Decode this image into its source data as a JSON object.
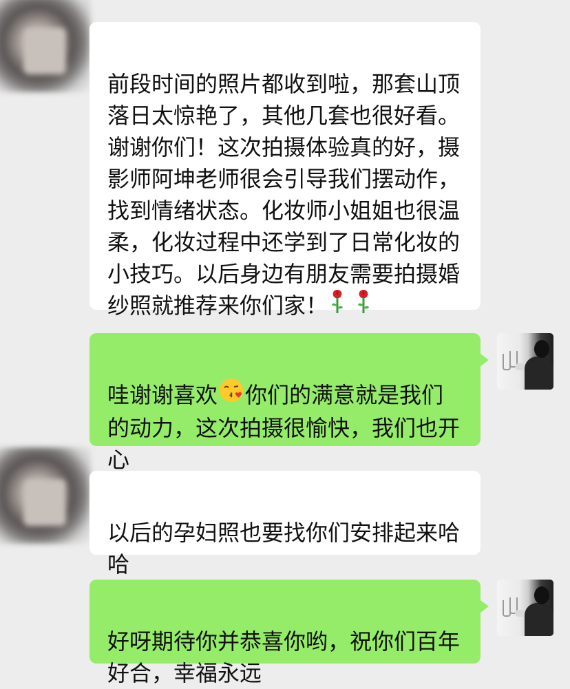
{
  "chat": {
    "messages": [
      {
        "side": "in",
        "text_before": "前段时间的照片都收到啦，那套山顶落日太惊艳了，其他几套也很好看。谢谢你们！这次拍摄体验真的好，摄影师阿坤老师很会引导我们摆动作，找到情绪状态。化妆师小姐姐也很温柔，化妆过程中还学到了日常化妆的小技巧。以后身边有朋友需要拍摄婚纱照就推荐来你们家！",
        "emoji": "rose-emoji x2"
      },
      {
        "side": "out",
        "text_before": "哇谢谢喜欢",
        "emoji": "kissing-face-emoji",
        "text_after": "你们的满意就是我们的动力，这次拍摄很愉快，我们也开心"
      },
      {
        "side": "in",
        "text_before": "以后的孕妇照也要找你们安排起来哈哈"
      },
      {
        "side": "out",
        "text_before": "好呀期待你并恭喜你哟，祝你们百年好合，幸福永远"
      }
    ]
  },
  "colors": {
    "background": "#ededed",
    "incoming_bubble": "#ffffff",
    "outgoing_bubble": "#95ec69",
    "text": "#111111"
  },
  "avatars": {
    "contact": "blurred-contact-avatar",
    "self": "woman-with-champagne-glasses-avatar"
  }
}
